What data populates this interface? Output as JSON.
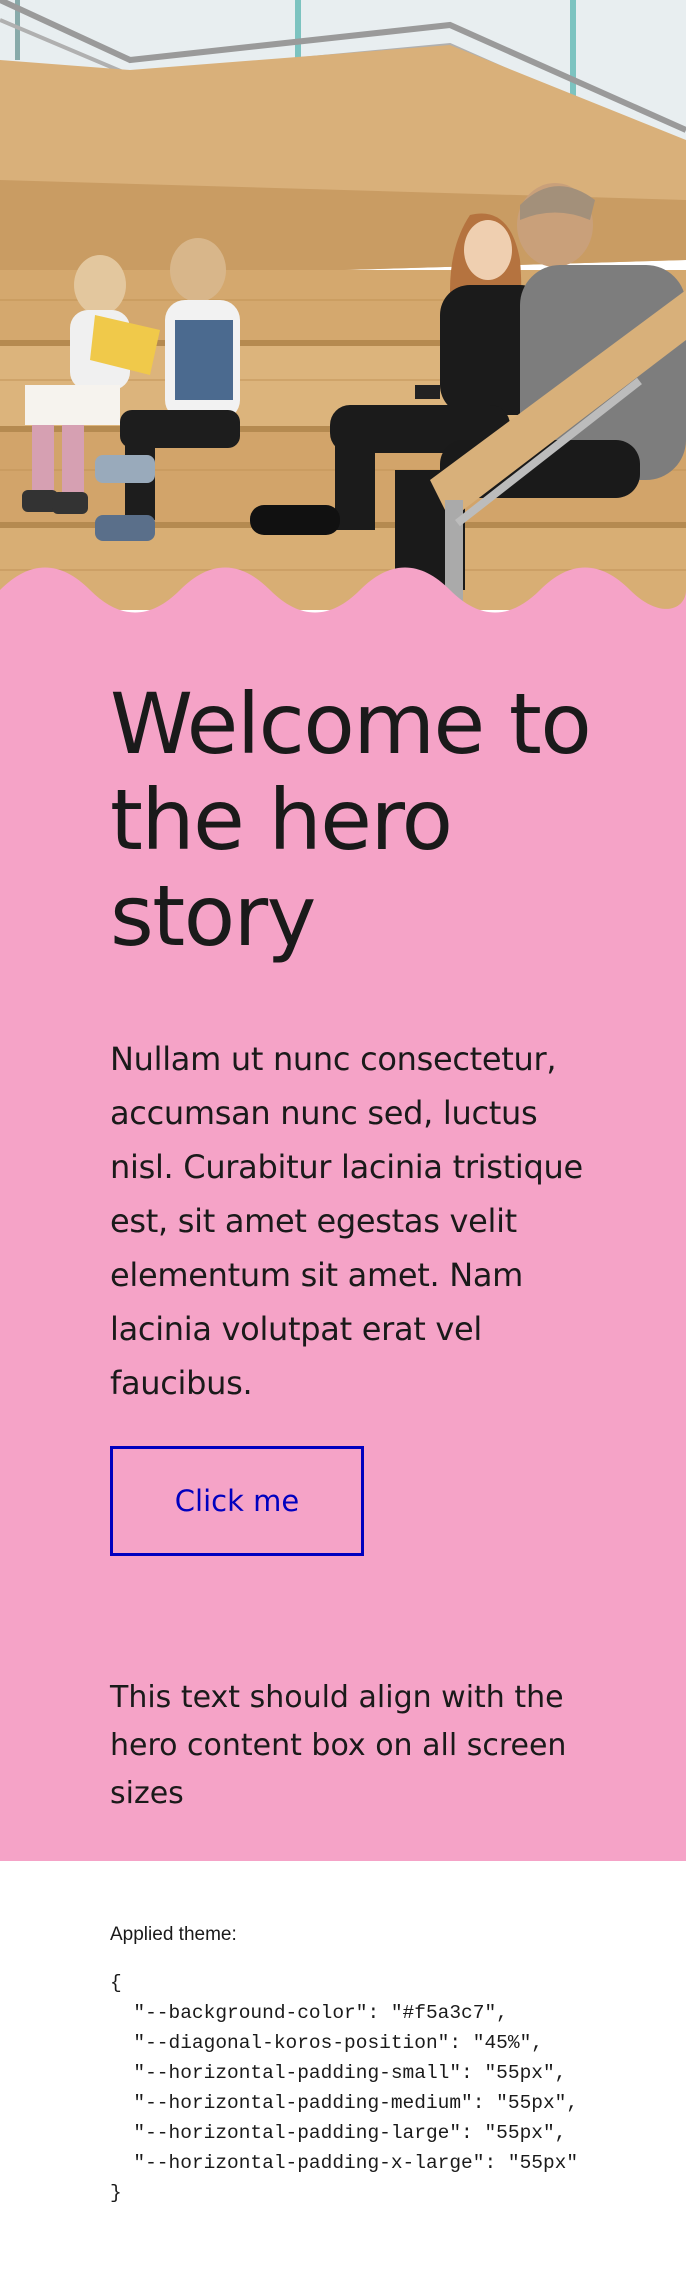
{
  "theme": {
    "background_color": "#f5a3c7",
    "accent_color": "#0000bf"
  },
  "hero": {
    "image_subject": "children-and-adults-sitting-on-wooden-steps-photo",
    "title": "Welcome to the hero story",
    "body": "Nullam ut nunc consectetur, accumsan nunc sed, luctus nisl. Curabitur lacinia tristique est, sit amet egestas velit elementum sit amet. Nam lacinia volutpat erat vel faucibus.",
    "button_label": "Click me"
  },
  "alignment_note": "This text should align with the hero content box on all screen sizes",
  "applied_theme": {
    "label": "Applied theme:",
    "code": "{\n  \"--background-color\": \"#f5a3c7\",\n  \"--diagonal-koros-position\": \"45%\",\n  \"--horizontal-padding-small\": \"55px\",\n  \"--horizontal-padding-medium\": \"55px\",\n  \"--horizontal-padding-large\": \"55px\",\n  \"--horizontal-padding-x-large\": \"55px\"\n}"
  }
}
